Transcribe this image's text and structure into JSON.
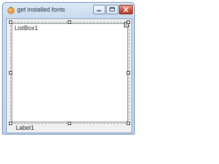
{
  "window": {
    "title": "get installed fonts",
    "icon": "form-icon",
    "controls": {
      "minimize": "minimize-icon",
      "maximize": "maximize-icon",
      "close": "close-icon"
    }
  },
  "form": {
    "listbox": {
      "text": "ListBox1"
    },
    "label": {
      "text": "Label1"
    }
  },
  "colors": {
    "close_button": "#d0533d",
    "frame": "#c9dbef"
  }
}
